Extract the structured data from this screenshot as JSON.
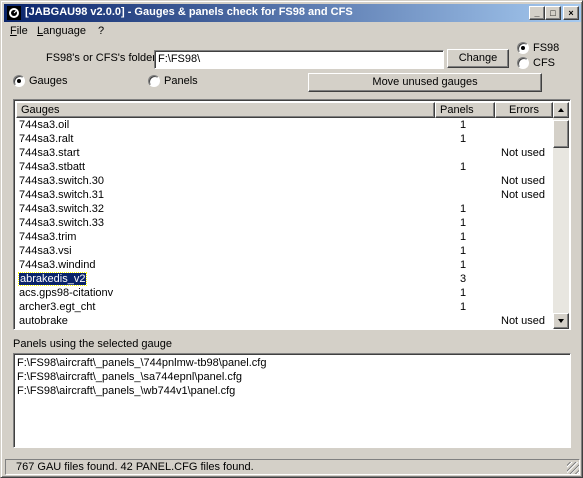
{
  "window": {
    "title": "[JABGAU98 v2.0.0] - Gauges & panels check for FS98 and CFS",
    "controls": {
      "minimize": "_",
      "maximize": "□",
      "close": "×"
    }
  },
  "menu": [
    "File",
    "Language",
    "?"
  ],
  "folder": {
    "label": "FS98's or CFS's folder",
    "value": "F:\\FS98\\",
    "change_label": "Change"
  },
  "sim": {
    "options": [
      {
        "label": "FS98",
        "checked": true
      },
      {
        "label": "CFS",
        "checked": false
      }
    ]
  },
  "view_mode": {
    "options": [
      {
        "label": "Gauges",
        "checked": true
      },
      {
        "label": "Panels",
        "checked": false
      }
    ]
  },
  "move_button": "Move unused gauges",
  "gauges_table": {
    "columns": [
      "Gauges",
      "Panels",
      "Errors"
    ],
    "rows": [
      {
        "name": "744sa3.oil",
        "panels": "1",
        "errors": ""
      },
      {
        "name": "744sa3.ralt",
        "panels": "1",
        "errors": ""
      },
      {
        "name": "744sa3.start",
        "panels": "",
        "errors": "Not used"
      },
      {
        "name": "744sa3.stbatt",
        "panels": "1",
        "errors": ""
      },
      {
        "name": "744sa3.switch.30",
        "panels": "",
        "errors": "Not used"
      },
      {
        "name": "744sa3.switch.31",
        "panels": "",
        "errors": "Not used"
      },
      {
        "name": "744sa3.switch.32",
        "panels": "1",
        "errors": ""
      },
      {
        "name": "744sa3.switch.33",
        "panels": "1",
        "errors": ""
      },
      {
        "name": "744sa3.trim",
        "panels": "1",
        "errors": ""
      },
      {
        "name": "744sa3.vsi",
        "panels": "1",
        "errors": ""
      },
      {
        "name": "744sa3.windind",
        "panels": "1",
        "errors": ""
      },
      {
        "name": "abrakedis_v2",
        "panels": "3",
        "errors": "",
        "selected": true
      },
      {
        "name": "acs.gps98-citationv",
        "panels": "1",
        "errors": ""
      },
      {
        "name": "archer3.egt_cht",
        "panels": "1",
        "errors": ""
      },
      {
        "name": "autobrake",
        "panels": "",
        "errors": "Not used"
      }
    ]
  },
  "panels_section": {
    "label": "Panels using the selected gauge",
    "items": [
      "F:\\FS98\\aircraft\\_panels_\\744pnlmw-tb98\\panel.cfg",
      "F:\\FS98\\aircraft\\_panels_\\sa744epnl\\panel.cfg",
      "F:\\FS98\\aircraft\\_panels_\\wb744v1\\panel.cfg"
    ]
  },
  "status": "767 GAU files found. 42 PANEL.CFG files found.",
  "colors": {
    "title_start": "#0a246a",
    "title_end": "#a6caf0",
    "face": "#d4d0c8",
    "selection": "#0a246a"
  }
}
